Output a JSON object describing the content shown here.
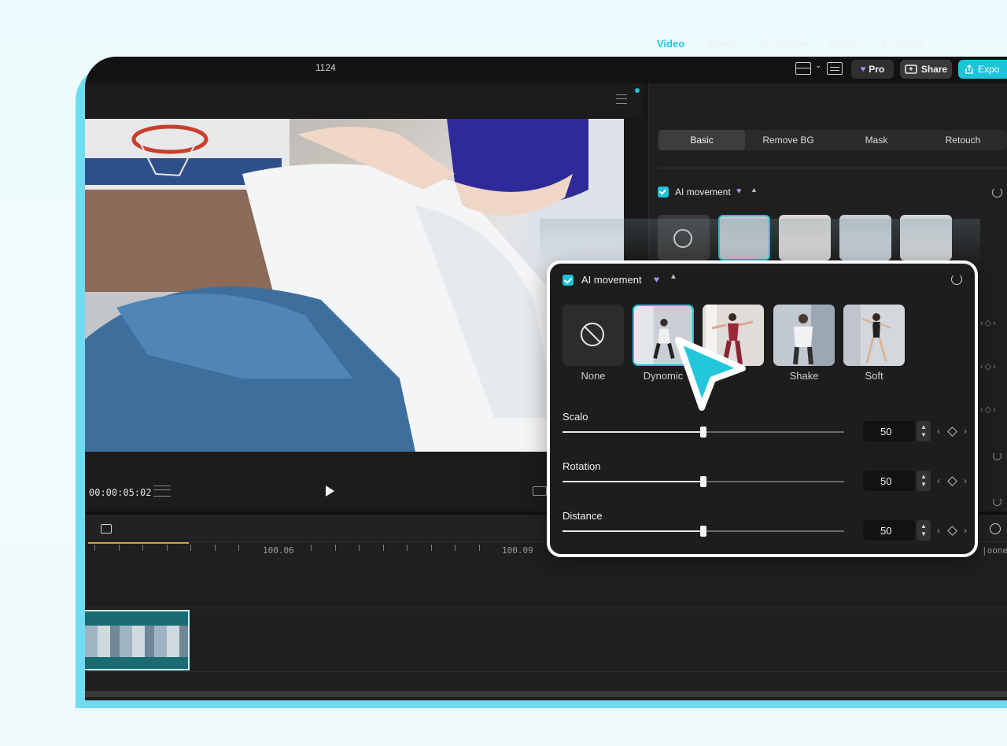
{
  "app": {
    "project_title": "1124",
    "pro_label": "Pro",
    "share_label": "Share",
    "export_label": "Expo"
  },
  "player": {
    "timecode": "00:00:05:02"
  },
  "timeline": {
    "ruler_labels": [
      "100.06",
      "100.09",
      "|oone"
    ]
  },
  "panel": {
    "tabs": [
      "Video",
      "Speed",
      "Animation",
      "Adjust",
      "AI styiize"
    ],
    "subtabs": [
      "Basic",
      "Remove BG",
      "Mask",
      "Retouch"
    ],
    "section_label": "AI movement"
  },
  "callout": {
    "title": "AI movement",
    "presets": [
      {
        "label": "None",
        "selected": false
      },
      {
        "label": "Dynomic",
        "selected": true
      },
      {
        "label": "",
        "selected": false
      },
      {
        "label": "Shake",
        "selected": false
      },
      {
        "label": "Soft",
        "selected": false
      }
    ],
    "params": [
      {
        "label": "Scalo",
        "value": "50",
        "level": 0.5
      },
      {
        "label": "Rotation",
        "value": "50",
        "level": 0.5
      },
      {
        "label": "Distance",
        "value": "50",
        "level": 0.5
      }
    ]
  },
  "colors": {
    "accent": "#1dc3d8",
    "pro_heart": "#b08cf5",
    "background": "#181818"
  }
}
